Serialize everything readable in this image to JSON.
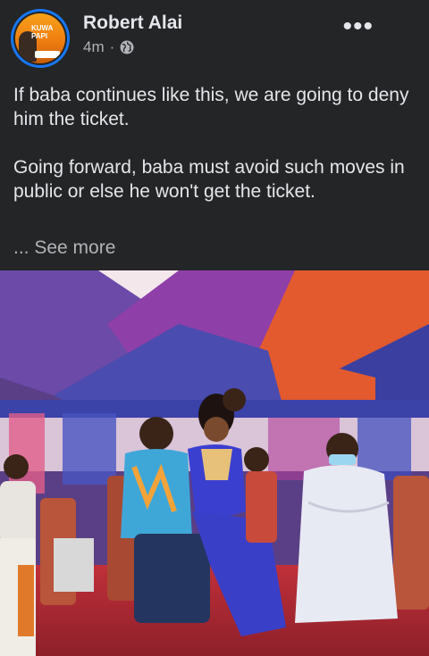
{
  "post": {
    "author": "Robert Alai",
    "timestamp": "4m",
    "separator": "·",
    "privacy_icon": "globe-icon",
    "more_icon": "more-horizontal-icon",
    "more_label": "•••",
    "paragraphs": [
      "If baba continues like this, we are going to deny him the ticket.",
      "Going forward, baba must avoid such moves in public or else he won't get the ticket."
    ],
    "see_more": "... See more"
  },
  "avatar": {
    "image": "profile-photo",
    "lettering": [
      "KUWA",
      "PAPI"
    ]
  },
  "photo": {
    "image": "event-photo-tent-stage"
  },
  "colors": {
    "background": "#242526",
    "text": "#e4e6eb",
    "secondary_text": "#b0b3b8",
    "avatar_ring": "#1877f2"
  }
}
